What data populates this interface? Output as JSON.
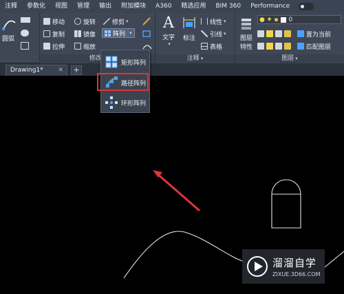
{
  "menu": {
    "tabs": [
      "注释",
      "参数化",
      "视图",
      "管理",
      "输出",
      "附加模块",
      "A360",
      "精选应用",
      "BIM 360",
      "Performance"
    ]
  },
  "ribbon": {
    "draw": {
      "arc": "圆弧"
    },
    "modify": {
      "title": "修改",
      "move": "移动",
      "rotate": "旋转",
      "trim": "修剪",
      "copy": "复制",
      "mirror": "镜像",
      "fillet": "圆角",
      "stretch": "拉伸",
      "scale": "缩放",
      "array": "阵列"
    },
    "annotation": {
      "title": "注释",
      "text": "文字",
      "dimension": "标注",
      "linear": "线性",
      "leader": "引线",
      "table": "表格"
    },
    "layers": {
      "title": "图层",
      "properties_1": "图层",
      "properties_2": "特性",
      "current_layer": "0",
      "set_current": "置为当前",
      "match_layer": "匹配图层"
    }
  },
  "document": {
    "tab_label": "Drawing1*",
    "close": "✕",
    "add": "+"
  },
  "array_menu": {
    "rect": "矩形阵列",
    "path": "路径阵列",
    "polar": "环形阵列"
  },
  "watermark": {
    "title": "溜溜自学",
    "url": "ZIXUE.3D66.COM"
  },
  "colors": {
    "highlight": "#e0343a",
    "ribbon": "#3f4757",
    "canvas": "#000000"
  }
}
